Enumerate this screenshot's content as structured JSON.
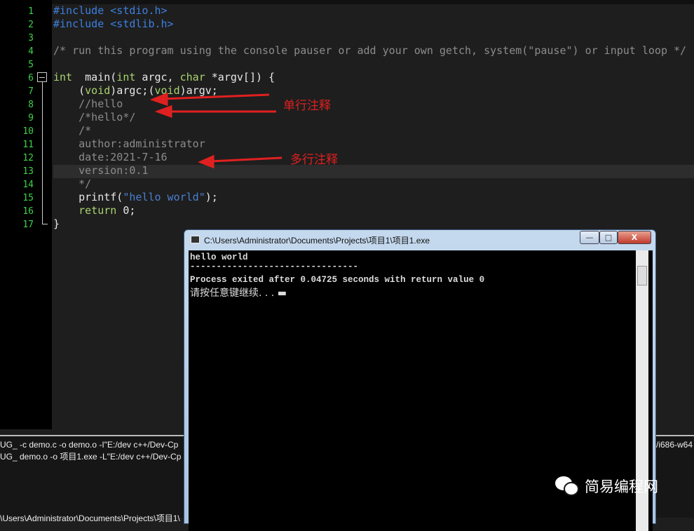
{
  "editor": {
    "line_numbers": [
      "1",
      "2",
      "3",
      "4",
      "5",
      "6",
      "7",
      "8",
      "9",
      "10",
      "11",
      "12",
      "13",
      "14",
      "15",
      "16",
      "17"
    ],
    "lines": [
      [
        [
          "pp",
          "#include <stdio.h>"
        ]
      ],
      [
        [
          "pp",
          "#include <stdlib.h>"
        ]
      ],
      [],
      [
        [
          "cm",
          "/* run this program using the console pauser or add your own getch, system(\"pause\") or input loop */"
        ]
      ],
      [],
      [
        [
          "kw",
          "int"
        ],
        [
          "",
          "  main("
        ],
        [
          "kw",
          "int"
        ],
        [
          "",
          " argc, "
        ],
        [
          "kw",
          "char"
        ],
        [
          "",
          " *argv[]) {"
        ]
      ],
      [
        [
          "",
          "    ("
        ],
        [
          "kw",
          "void"
        ],
        [
          "",
          ")argc;("
        ],
        [
          "kw",
          "void"
        ],
        [
          "",
          ")argv;"
        ]
      ],
      [
        [
          "cm",
          "    //hello"
        ]
      ],
      [
        [
          "cm",
          "    /*hello*/"
        ]
      ],
      [
        [
          "cm",
          "    /*"
        ]
      ],
      [
        [
          "cm",
          "    author:administrator"
        ]
      ],
      [
        [
          "cm",
          "    date:2021-7-16"
        ]
      ],
      [
        [
          "cm",
          "    version:0.1"
        ]
      ],
      [
        [
          "cm",
          "    */"
        ]
      ],
      [
        [
          "",
          "    printf("
        ],
        [
          "st",
          "\"hello world\""
        ],
        [
          "",
          ");"
        ]
      ],
      [
        [
          "",
          "    "
        ],
        [
          "kw",
          "return"
        ],
        [
          "",
          " 0;"
        ]
      ],
      [
        [
          "",
          "}"
        ]
      ]
    ]
  },
  "annotations": {
    "single_line": "单行注释",
    "multi_line": "多行注释",
    "color": "#e02020"
  },
  "compile_log": {
    "line1": "UG_ -c demo.c -o demo.o -I\"E:/dev c++/Dev-Cp",
    "line1_right": "/i686-w64",
    "line2": "UG_ demo.o -o 项目1.exe -L\"E:/dev c++/Dev-Cp",
    "line3": "\\Users\\Administrator\\Documents\\Projects\\项目1\\"
  },
  "console": {
    "title": "C:\\Users\\Administrator\\Documents\\Projects\\项目1\\项目1.exe",
    "minimize": "—",
    "maximize": "□",
    "close": "X",
    "output": [
      "hello world",
      "--------------------------------",
      "Process exited after 0.04725 seconds with return value 0",
      "请按任意键继续. . . ▬"
    ]
  },
  "watermark": {
    "text": "简易编程网",
    "icon": "wechat-icon"
  }
}
